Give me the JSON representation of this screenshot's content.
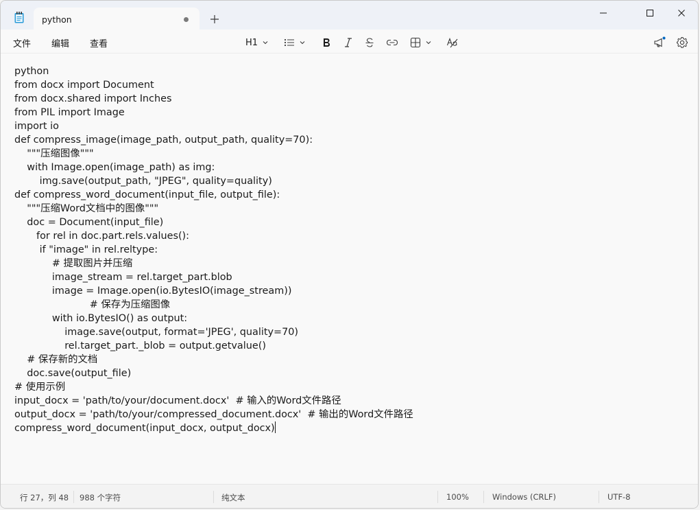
{
  "tab": {
    "title": "python"
  },
  "menu": {
    "file": "文件",
    "edit": "编辑",
    "view": "查看"
  },
  "toolbar": {
    "heading": "H1"
  },
  "editor": {
    "lines": [
      "python",
      "from docx import Document",
      "from docx.shared import Inches",
      "from PIL import Image",
      "import io",
      "def compress_image(image_path, output_path, quality=70):",
      "    \"\"\"压缩图像\"\"\"",
      "    with Image.open(image_path) as img:",
      "        img.save(output_path, \"JPEG\", quality=quality)",
      "def compress_word_document(input_file, output_file):",
      "    \"\"\"压缩Word文档中的图像\"\"\"",
      "    doc = Document(input_file)",
      "       for rel in doc.part.rels.values():",
      "        if \"image\" in rel.reltype:",
      "            # 提取图片并压缩",
      "            image_stream = rel.target_part.blob",
      "            image = Image.open(io.BytesIO(image_stream))",
      "                        # 保存为压缩图像",
      "            with io.BytesIO() as output:",
      "                image.save(output, format='JPEG', quality=70)",
      "                rel.target_part._blob = output.getvalue()",
      "    # 保存新的文档",
      "    doc.save(output_file)",
      "# 使用示例",
      "input_docx = 'path/to/your/document.docx'  # 输入的Word文件路径",
      "output_docx = 'path/to/your/compressed_document.docx'  # 输出的Word文件路径",
      "compress_word_document(input_docx, output_docx)"
    ]
  },
  "status": {
    "position": "行 27，列 48",
    "chars": "988 个字符",
    "format": "纯文本",
    "zoom": "100%",
    "line_ending": "Windows (CRLF)",
    "encoding": "UTF-8"
  }
}
